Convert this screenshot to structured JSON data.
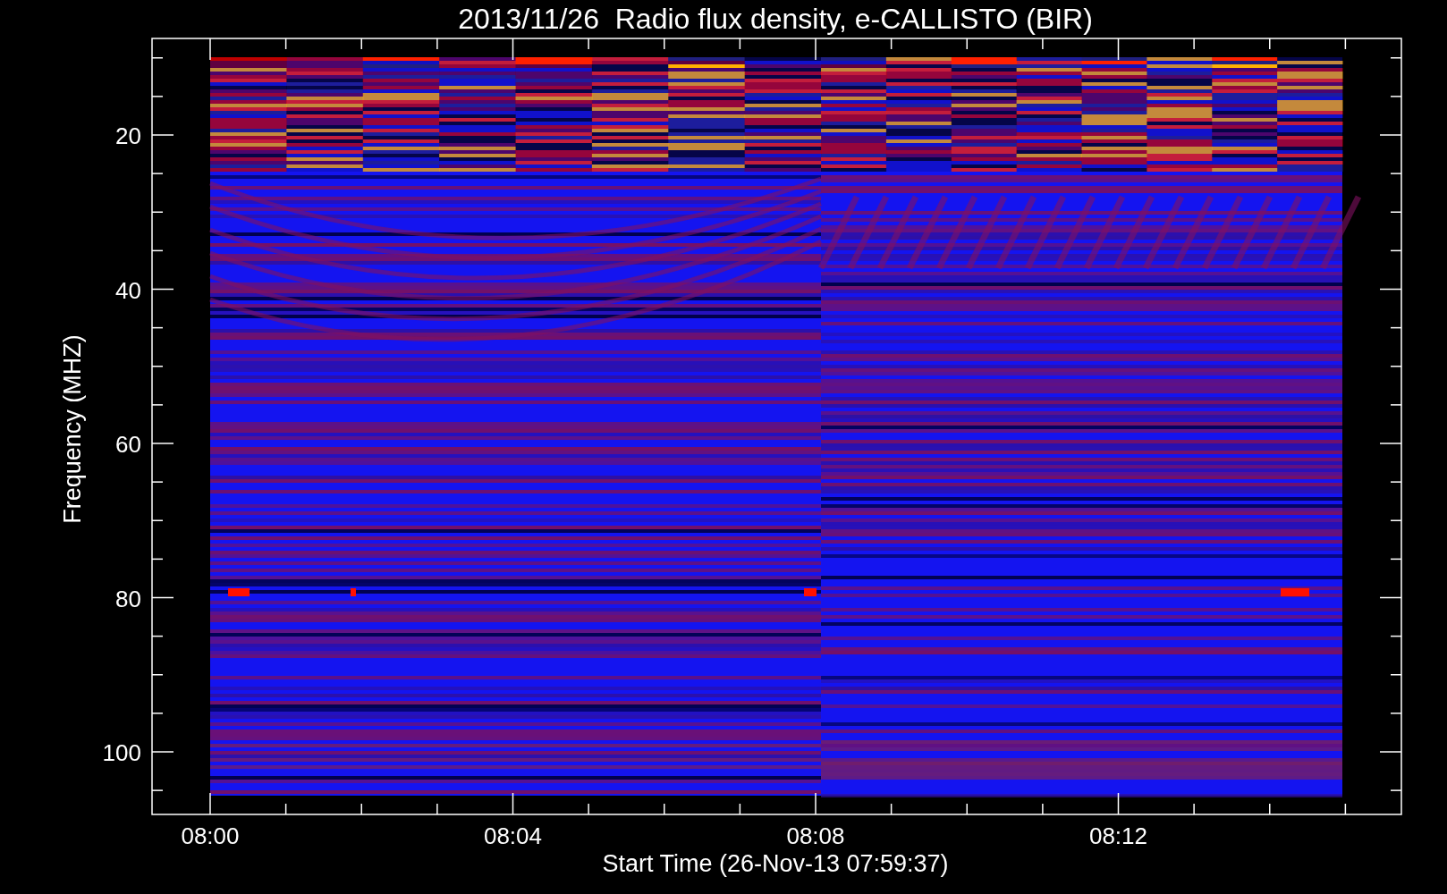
{
  "title": "2013/11/26  Radio flux density, e-CALLISTO (BIR)",
  "xlabel": "Start Time (26-Nov-13 07:59:37)",
  "ylabel": "Frequency (MHZ)",
  "yticks": [
    "20",
    "40",
    "60",
    "80",
    "100"
  ],
  "xticks": [
    "08:00",
    "08:04",
    "08:08",
    "08:12"
  ]
}
